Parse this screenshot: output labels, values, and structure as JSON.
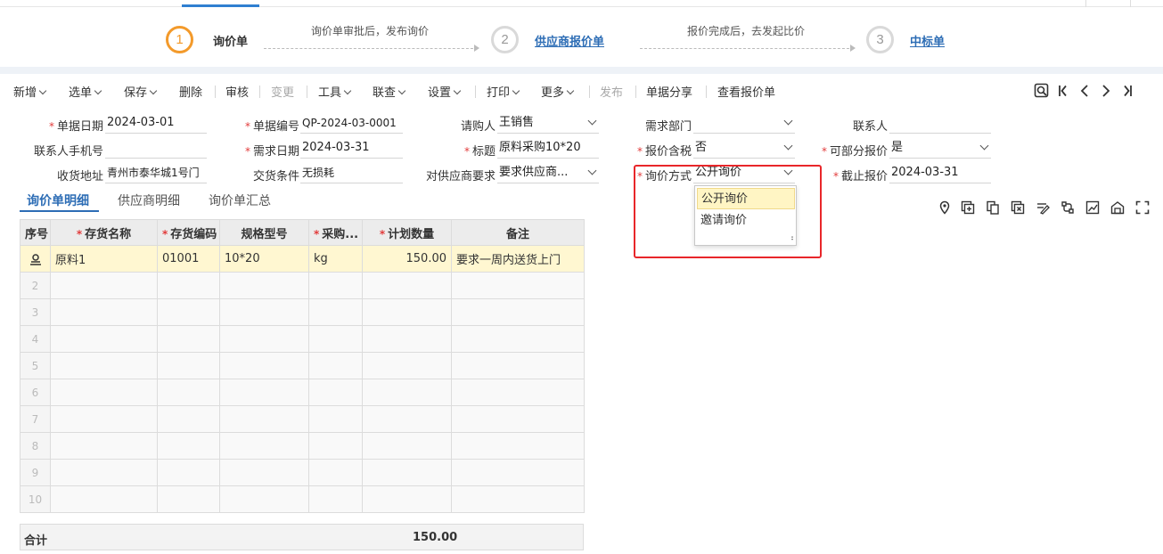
{
  "steps": [
    {
      "num": "1",
      "label": "询价单"
    },
    {
      "num": "2",
      "label": "供应商报价单"
    },
    {
      "num": "3",
      "label": "中标单"
    }
  ],
  "step_notes": [
    "询价单审批后，发布询价",
    "报价完成后，去发起比价"
  ],
  "toolbar": {
    "items": [
      "新增",
      "选单",
      "保存",
      "删除",
      "审核",
      "变更",
      "工具",
      "联查",
      "设置",
      "打印",
      "更多",
      "发布",
      "单据分享",
      "查看报价单"
    ]
  },
  "form": {
    "doc_date_label": "单据日期",
    "doc_date": "2024-03-01",
    "doc_no_label": "单据编号",
    "doc_no": "QP-2024-03-0001",
    "buyer_label": "请购人",
    "buyer": "王销售",
    "dept_label": "需求部门",
    "dept": "",
    "contact_label": "联系人",
    "contact": "",
    "phone_label": "联系人手机号",
    "phone": "",
    "need_date_label": "需求日期",
    "need_date": "2024-03-31",
    "title_label": "标题",
    "title": "原料采购10*20",
    "tax_label": "报价含税",
    "tax": "否",
    "partial_label": "可部分报价",
    "partial": "是",
    "address_label": "收货地址",
    "address": "青州市泰华城1号门",
    "delivery_label": "交货条件",
    "delivery": "无损耗",
    "supplier_req_label": "对供应商要求",
    "supplier_req": "要求供应商...",
    "method_label": "询价方式",
    "method": "公开询价",
    "deadline_label": "截止报价",
    "deadline": "2024-03-31"
  },
  "method_options": [
    "公开询价",
    "邀请询价"
  ],
  "tabs": [
    "询价单明细",
    "供应商明细",
    "询价单汇总"
  ],
  "grid": {
    "headers": [
      "序号",
      "存货名称",
      "存货编码",
      "规格型号",
      "采购...",
      "计划数量",
      "备注"
    ],
    "rows": [
      {
        "name": "原料1",
        "code": "01001",
        "spec": "10*20",
        "unit": "kg",
        "qty": "150.00",
        "note": "要求一周内送货上门"
      }
    ],
    "empty_rows": [
      "2",
      "3",
      "4",
      "5",
      "6",
      "7",
      "8",
      "9",
      "10"
    ]
  },
  "totals": {
    "label": "合计",
    "qty": "150.00"
  },
  "colors": {
    "accent": "#2d6db5",
    "step_active": "#f39a2b",
    "highlight": "#e8262a",
    "selected_row": "#fff7d1"
  }
}
